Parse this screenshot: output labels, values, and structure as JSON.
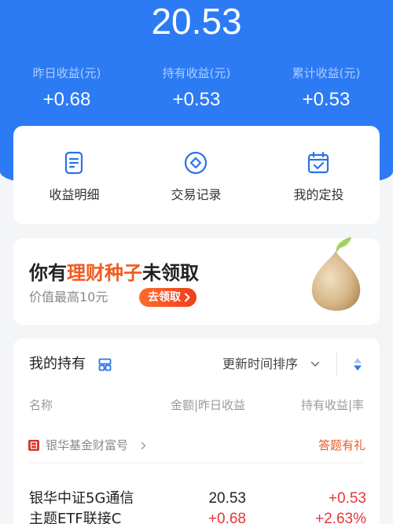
{
  "header": {
    "total_amount": "20.53",
    "stats": [
      {
        "label": "昨日收益(元)",
        "value": "+0.68"
      },
      {
        "label": "持有收益(元)",
        "value": "+0.53"
      },
      {
        "label": "累计收益(元)",
        "value": "+0.53"
      }
    ]
  },
  "shortcuts": [
    {
      "label": "收益明细",
      "icon": "document-icon"
    },
    {
      "label": "交易记录",
      "icon": "diamond-circle-icon"
    },
    {
      "label": "我的定投",
      "icon": "calendar-check-icon"
    }
  ],
  "promo": {
    "title_prefix": "你有",
    "title_highlight": "理财种子",
    "title_suffix": "未领取",
    "subtitle": "价值最高10元",
    "button_label": "去领取",
    "illustration": "seed-icon"
  },
  "holdings": {
    "title": "我的持有",
    "sort_label": "更新时间排序",
    "columns": {
      "name": "名称",
      "amount": "金额|昨日收益",
      "profit": "持有收益|率"
    },
    "provider": {
      "name": "银华基金财富号",
      "promo_label": "答题有礼"
    },
    "funds": [
      {
        "name_line1": "银华中证5G通信",
        "name_line2": "主题ETF联接C",
        "amount": "20.53",
        "yesterday_profit": "+0.68",
        "holding_profit": "+0.53",
        "holding_rate": "+2.63%"
      }
    ]
  },
  "colors": {
    "brand_blue": "#2c7bf5",
    "icon_blue": "#2a72ea",
    "accent_orange": "#f25a1f",
    "profit_red": "#e8343a"
  }
}
